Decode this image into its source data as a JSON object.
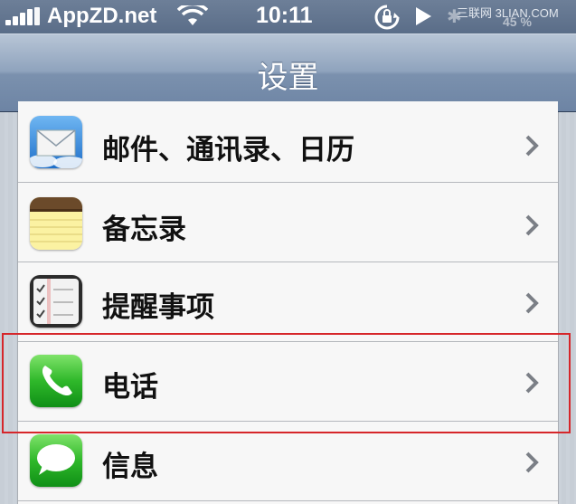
{
  "status_bar": {
    "carrier": "AppZD.net",
    "time": "10:11",
    "watermark": "三联网 3LIAN.COM",
    "battery_text": "45 %",
    "bluetooth_glyph": "✱"
  },
  "nav": {
    "title": "设置"
  },
  "settings_rows": [
    {
      "label": "邮件、通讯录、日历",
      "icon": "mail-icon"
    },
    {
      "label": "备忘录",
      "icon": "notes-icon"
    },
    {
      "label": "提醒事项",
      "icon": "reminders-icon"
    },
    {
      "label": "电话",
      "icon": "phone-icon"
    },
    {
      "label": "信息",
      "icon": "messages-icon"
    }
  ],
  "colors": {
    "highlight": "#d6262a",
    "nav_bar": "#6d84a4",
    "phone_green": "#2fb82a"
  }
}
